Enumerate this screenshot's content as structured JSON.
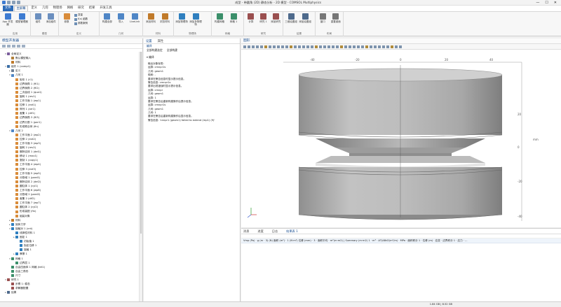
{
  "window": {
    "title": "成型 - 带圆角 (2D) 静态分析 - 2D 模型 - COMSOL Multiphysics",
    "minimize": "—",
    "maximize": "☐",
    "close": "✕"
  },
  "menu_tabs": [
    "文件",
    "主屏幕",
    "定义",
    "几何",
    "物理场",
    "网格",
    "研究",
    "结果",
    "开发工具"
  ],
  "active_tab": "主屏幕",
  "ribbon": {
    "groups": [
      {
        "label": "应用",
        "buttons": [
          "App 开发器",
          "模型管理器"
        ]
      },
      {
        "label": "模型",
        "buttons": [
          "组件",
          "添加组件"
        ]
      },
      {
        "label": "定义",
        "buttons": [
          "参数"
        ],
        "small": [
          "变量",
          "f(x) 函数",
          "参数案例"
        ]
      },
      {
        "label": "几何",
        "buttons": [
          "构建全部",
          "导入",
          "LiveLink"
        ]
      },
      {
        "label": "材料",
        "buttons": [
          "添加材料",
          "浏览材料"
        ]
      },
      {
        "label": "物理场",
        "buttons": [
          "添加物理场",
          "添加多物理场"
        ]
      },
      {
        "label": "网格",
        "buttons": [
          "构建网格",
          "网格 1"
        ]
      },
      {
        "label": "研究",
        "buttons": [
          "计算",
          "研究 1",
          "添加研究"
        ]
      },
      {
        "label": "结果",
        "buttons": [
          "三维绘图组",
          "添加绘图组"
        ]
      },
      {
        "label": "布局",
        "buttons": [
          "窗口",
          "重置桌面"
        ]
      }
    ]
  },
  "model_builder": {
    "title": "模型开发器",
    "tree": [
      {
        "d": 1,
        "t": "全局定义",
        "e": "▾",
        "c": "#7a5c9c"
      },
      {
        "d": 2,
        "t": "默认模型输入",
        "e": "",
        "c": "#b07f3a"
      },
      {
        "d": 2,
        "t": "材料",
        "e": "",
        "c": "#c07a2a"
      },
      {
        "d": 1,
        "t": "组件 1 (comp1)",
        "e": "▾",
        "c": "#3a6ea5"
      },
      {
        "d": 2,
        "t": "定义",
        "e": "▸",
        "c": "#6d7f95"
      },
      {
        "d": 2,
        "t": "几何 1",
        "e": "▾",
        "c": "#4f86c6"
      },
      {
        "d": 3,
        "t": "矩形 1 (r1)",
        "e": "",
        "c": "#d98c3a"
      },
      {
        "d": 3,
        "t": "边界倒角 1 (fil1)",
        "e": "",
        "c": "#d98c3a"
      },
      {
        "d": 3,
        "t": "边界倒角 2 (fil2)",
        "e": "",
        "c": "#d98c3a"
      },
      {
        "d": 3,
        "t": "二次曲线 1 (qua1)",
        "e": "",
        "c": "#d98c3a"
      },
      {
        "d": 3,
        "t": "旋转 1 (rev1)",
        "e": "",
        "c": "#d98c3a"
      },
      {
        "d": 3,
        "t": "工作平面 1 (wp1)",
        "e": "",
        "c": "#d98c3a"
      },
      {
        "d": 3,
        "t": "拉伸 1 (ext1)",
        "e": "",
        "c": "#d98c3a"
      },
      {
        "d": 3,
        "t": "阵列 1 (arr1)",
        "e": "",
        "c": "#d98c3a"
      },
      {
        "d": 3,
        "t": "差集 1 (dif1)",
        "e": "",
        "c": "#d98c3a"
      },
      {
        "d": 3,
        "t": "边界倒角 3 (fil3)",
        "e": "",
        "c": "#d98c3a"
      },
      {
        "d": 3,
        "t": "边界分割 1 (par1)",
        "e": "",
        "c": "#d98c3a"
      },
      {
        "d": 3,
        "t": "形成联合体 (fin)",
        "e": "",
        "c": "#d98c3a"
      },
      {
        "d": 2,
        "t": "几何 2",
        "e": "▾",
        "c": "#4f86c6"
      },
      {
        "d": 3,
        "t": "工作平面 2 (wp2)",
        "e": "",
        "c": "#d98c3a"
      },
      {
        "d": 3,
        "t": "拉伸 2 (ext2)",
        "e": "",
        "c": "#d98c3a"
      },
      {
        "d": 3,
        "t": "工作平面 3 (wp3)",
        "e": "",
        "c": "#d98c3a"
      },
      {
        "d": 3,
        "t": "旋转 2 (rev2)",
        "e": "",
        "c": "#d98c3a"
      },
      {
        "d": 3,
        "t": "删除实体 1 (del1)",
        "e": "",
        "c": "#d98c3a"
      },
      {
        "d": 3,
        "t": "移动 1 (mov1)",
        "e": "",
        "c": "#d98c3a"
      },
      {
        "d": 3,
        "t": "复制 1 (copy1)",
        "e": "",
        "c": "#d98c3a"
      },
      {
        "d": 3,
        "t": "工作平面 4 (wp4)",
        "e": "",
        "c": "#d98c3a"
      },
      {
        "d": 3,
        "t": "拉伸 3 (ext3)",
        "e": "",
        "c": "#d98c3a"
      },
      {
        "d": 3,
        "t": "工作平面 5 (wp5)",
        "e": "",
        "c": "#d98c3a"
      },
      {
        "d": 3,
        "t": "分割域 1 (pard1)",
        "e": "",
        "c": "#d98c3a"
      },
      {
        "d": 3,
        "t": "删除实体 2 (del2)",
        "e": "",
        "c": "#d98c3a"
      },
      {
        "d": 3,
        "t": "圆柱体 1 (cyl1)",
        "e": "",
        "c": "#d98c3a"
      },
      {
        "d": 3,
        "t": "工作平面 6 (wp6)",
        "e": "",
        "c": "#d98c3a"
      },
      {
        "d": 3,
        "t": "分割域 2 (pard2)",
        "e": "",
        "c": "#d98c3a"
      },
      {
        "d": 3,
        "t": "差集 2 (dif2)",
        "e": "",
        "c": "#d98c3a"
      },
      {
        "d": 3,
        "t": "工作平面 7 (wp7)",
        "e": "",
        "c": "#d98c3a"
      },
      {
        "d": 3,
        "t": "圆柱体 2 (cyl2)",
        "e": "",
        "c": "#d98c3a"
      },
      {
        "d": 3,
        "t": "形成装配 (fin)",
        "e": "",
        "c": "#d98c3a"
      },
      {
        "d": 3,
        "t": "组装对象",
        "e": "",
        "c": "#d98c3a"
      },
      {
        "d": 2,
        "t": "材料",
        "e": "▸",
        "c": "#c07a2a"
      },
      {
        "d": 2,
        "t": "固体力学",
        "e": "▸",
        "c": "#2f7fbf"
      },
      {
        "d": 2,
        "t": "接触对 1 (cnt)",
        "e": "▾",
        "c": "#2f7fbf"
      },
      {
        "d": 3,
        "t": "线弹性材料 1",
        "e": "",
        "c": "#2f7fbf"
      },
      {
        "d": 3,
        "t": "固定 1",
        "e": "▸",
        "c": "#2f7fbf"
      },
      {
        "d": 4,
        "t": "初始值 1",
        "e": "",
        "c": "#2f7fbf"
      },
      {
        "d": 4,
        "t": "指定位移 1",
        "e": "",
        "c": "#2f7fbf"
      },
      {
        "d": 4,
        "t": "接触 1",
        "e": "",
        "c": "#2f7fbf"
      },
      {
        "d": 3,
        "t": "摩擦 1",
        "e": "▸",
        "c": "#2f7fbf"
      },
      {
        "d": 2,
        "t": "网格 1",
        "e": "▾",
        "c": "#3b8f6a"
      },
      {
        "d": 3,
        "t": "边界层 1",
        "e": "",
        "c": "#3b8f6a"
      },
      {
        "d": 2,
        "t": "自由四面体 1 网格 (tet1)",
        "e": "",
        "c": "#3b8f6a"
      },
      {
        "d": 2,
        "t": "自由三角形",
        "e": "",
        "c": "#3b8f6a"
      },
      {
        "d": 2,
        "t": "尺寸",
        "e": "",
        "c": "#3b8f6a"
      },
      {
        "d": 1,
        "t": "研究 1",
        "e": "▾",
        "c": "#9a4f4f"
      },
      {
        "d": 2,
        "t": "步骤 1: 稳态",
        "e": "",
        "c": "#9a4f4f"
      },
      {
        "d": 2,
        "t": "求解器配置",
        "e": "",
        "c": "#9a4f4f"
      },
      {
        "d": 1,
        "t": "结果",
        "e": "▸",
        "c": "#4e6a8c"
      }
    ]
  },
  "settings": {
    "title": "设置",
    "second_tab": "属性",
    "node": "编译",
    "toolbar": [
      "全部构建选定",
      "全部构建"
    ],
    "section": "编译",
    "lines": [
      "输出对象标签:",
      "  运算: cmnpr1s",
      "  几何: geom1",
      "  映射: -",
      "要求在警告信息时显示提示信息。",
      "  警告信息: cmnpr1s",
      "要求出现错误时显示提示信息。",
      "  运算: cmnpr",
      "  几何: geom1",
      "  运算: 1",
      "要求在警告后重新构建操作后提示信息。",
      "  运算: cmnpr1s",
      "  几何: geom1",
      "  几何: 1",
      "要求在警告后重新构建操作后显示信息。",
      "  警告信息: 'cnnpr1 (geom1) failed to extend (mp1) (9)'"
    ]
  },
  "graphics": {
    "title": "图形",
    "axis_labels": {
      "top": [
        "-40",
        "-20",
        "0",
        "20",
        "40"
      ],
      "right": [
        "20",
        "0",
        "-20",
        "-40"
      ],
      "unit": "mm"
    }
  },
  "messages": {
    "tabs": [
      "消息",
      "进度",
      "日志",
      "结果表 1"
    ],
    "active": "结果表 1",
    "log_line": "Vmp (Pa) · g (m · 3) (N) 面积 (m²) · 1 (N·m²) 位移 (mm) · 3 · 面积平均 · m²(m·m2) | Summary (m·m2) 1 · m³ · ΔT/ΔBd2(m²/m) · MPa · 面积积分 1 · 位移 (m) · 应变 · 边界积分 1 · 应力 · ...",
    "status": "1.84 GB | 8.52 GB"
  },
  "colors": {
    "accent": "#2d6bb8",
    "geometry_gray": "#b5b5b5"
  }
}
